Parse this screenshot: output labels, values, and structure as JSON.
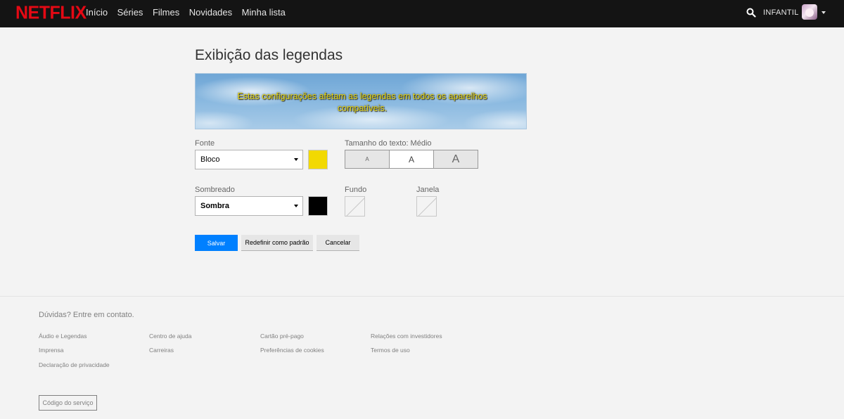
{
  "header": {
    "logo": "NETFLIX",
    "nav": [
      "Início",
      "Séries",
      "Filmes",
      "Novidades",
      "Minha lista"
    ],
    "profile_name": "INFANTIL"
  },
  "main": {
    "title": "Exibição das legendas",
    "preview_text": "Estas configurações afetam as legendas em todos os aparelhos compatíveis.",
    "font": {
      "label": "Fonte",
      "value": "Bloco",
      "color": "#f2d902"
    },
    "text_size": {
      "label": "Tamanho do texto: Médio",
      "options": [
        "A",
        "A",
        "A"
      ],
      "selected": 1
    },
    "shadow": {
      "label": "Sombreado",
      "value": "Sombra",
      "color": "#000000"
    },
    "background": {
      "label": "Fundo"
    },
    "window": {
      "label": "Janela"
    },
    "buttons": {
      "save": "Salvar",
      "reset": "Redefinir como padrão",
      "cancel": "Cancelar"
    }
  },
  "footer": {
    "contact": "Dúvidas? Entre em contato.",
    "links": [
      "Áudio e Legendas",
      "Imprensa",
      "Declaração de privacidade",
      "Centro de ajuda",
      "Carreiras",
      "Cartão pré-pago",
      "Preferências de cookies",
      "Relações com investidores",
      "Termos de uso"
    ],
    "service_code": "Código do serviço"
  },
  "colors": {
    "brand": "#e50914",
    "header_bg": "#141414",
    "page_bg": "#f3f3f3",
    "primary_button": "#0080ff",
    "subtitle_text": "#e8d80f"
  }
}
